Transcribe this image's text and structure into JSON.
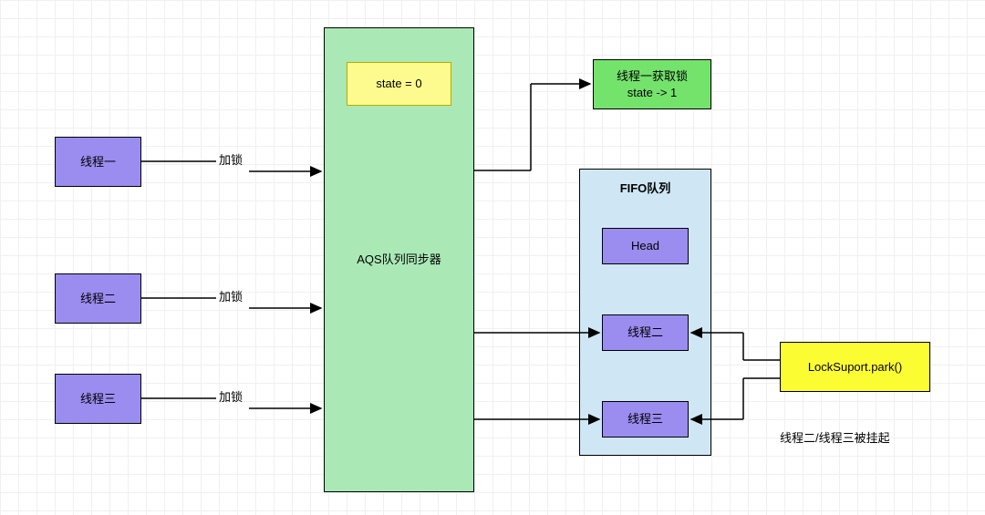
{
  "threads": {
    "t1": "线程一",
    "t2": "线程二",
    "t3": "线程三"
  },
  "lockLabels": {
    "l1": "加锁",
    "l2": "加锁",
    "l3": "加锁"
  },
  "aqs": {
    "title": "AQS队列同步器",
    "state": "state = 0"
  },
  "acquired": {
    "line1": "线程一获取锁",
    "line2": "state -> 1"
  },
  "fifo": {
    "title": "FIFO队列",
    "head": "Head",
    "n2": "线程二",
    "n3": "线程三"
  },
  "park": {
    "call": "LockSuport.park()",
    "note": "线程二/线程三被挂起"
  }
}
